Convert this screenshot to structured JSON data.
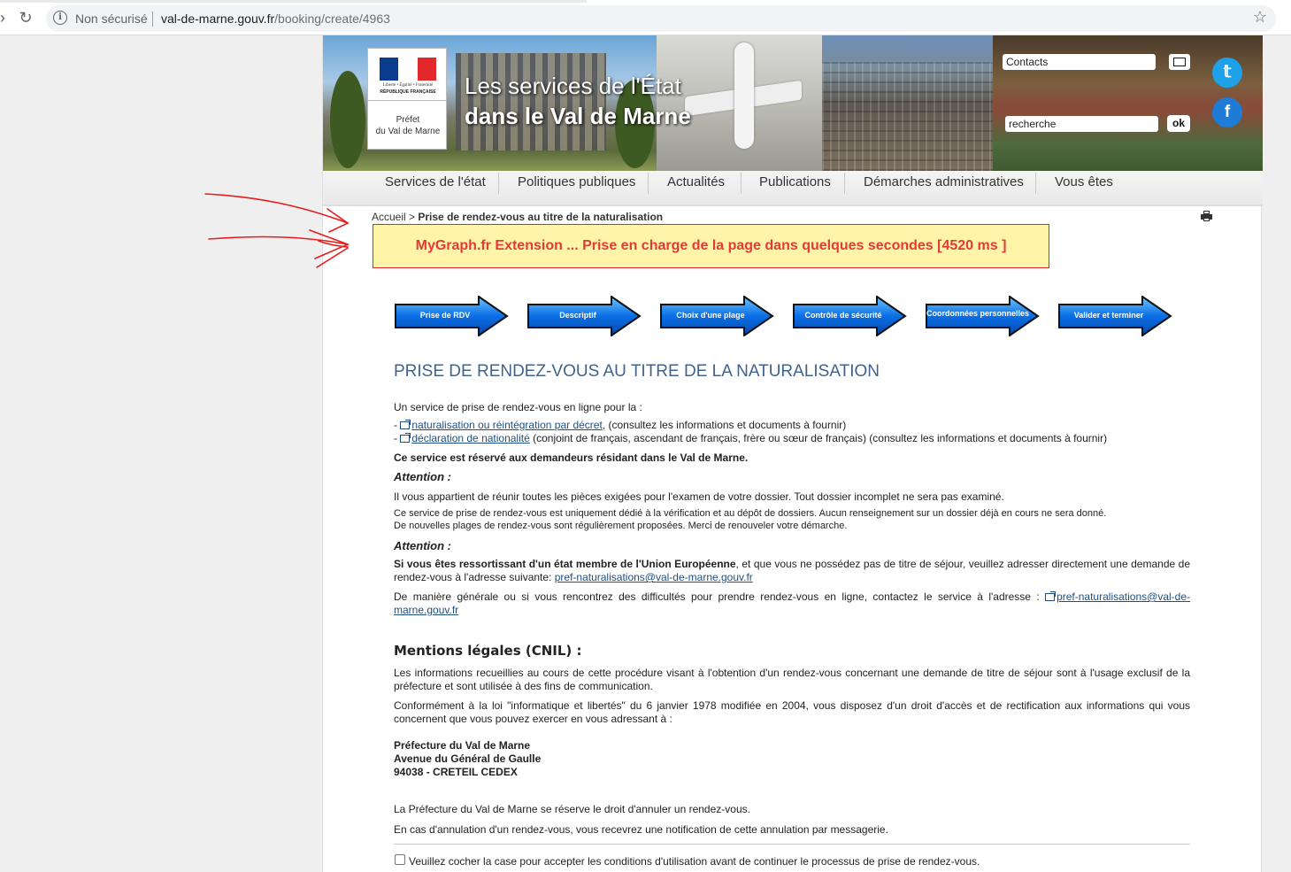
{
  "browser": {
    "security": "Non sécurisé",
    "url_host": "val-de-marne.gouv.fr",
    "url_path": "/booking/create/4963"
  },
  "banner": {
    "logo_motto": "Liberté • Égalité • Fraternité",
    "logo_republic": "RÉPUBLIQUE FRANÇAISE",
    "logo_prefet_line1": "Préfet",
    "logo_prefet_line2": "du Val de Marne",
    "title_line1": "Les services de l'État",
    "title_line2": "dans le Val de Marne",
    "contacts": "Contacts",
    "search_value": "recherche",
    "ok": "ok",
    "flag_colors": [
      "#0b3d8f",
      "#ffffff",
      "#e3282c"
    ],
    "twitter_color": "#1ea1e8",
    "facebook_color": "#1e7bd6"
  },
  "menu": {
    "items": [
      "Services de l'état",
      "Politiques publiques",
      "Actualités",
      "Publications",
      "Démarches administratives",
      "Vous êtes"
    ]
  },
  "breadcrumb": {
    "home": "Accueil",
    "sep": " > ",
    "current": "Prise de rendez-vous au titre de la naturalisation"
  },
  "notice": "MyGraph.fr Extension ... Prise en charge de la page dans quelques secondes [4520 ms ]",
  "steps": [
    "Prise de RDV",
    "Descriptif",
    "Choix d'une plage",
    "Contrôle de sécurité",
    "Coordonnées personnelles",
    "Valider et terminer"
  ],
  "content": {
    "title": "PRISE DE RENDEZ-VOUS AU TITRE DE LA NATURALISATION",
    "intro": "Un service de prise de rendez-vous en ligne pour la  :",
    "dash": "- ",
    "link1": "naturalisation ou réintégration par décret",
    "link1_rest": ",  (consultez les informations et documents à fournir)",
    "link2": "déclaration de nationalité",
    "link2_rest": "  (conjoint de français, ascendant de français, frère ou sœur de français) (consultez les informations et documents à fournir)",
    "reserved": "Ce service est réservé aux demandeurs résidant dans le Val de Marne.",
    "attention": "Attention  :",
    "pieces": " Il vous appartient de réunir toutes les pièces exigées pour l'examen de votre dossier. Tout dossier incomplet ne sera pas examiné.",
    "dedie": "Ce service de prise de rendez-vous est uniquement dédié à la vérification et au dépôt de dossiers. Aucun renseignement sur un dossier déjà en cours ne sera donné.",
    "nouvelles": "De nouvelles plages de rendez-vous sont régulièrement proposées. Merci de renouveler votre démarche.",
    "ue_bold": "Si vous êtes ressortissant d'un état membre de l'Union Européenne",
    "ue_rest": ", et que vous ne possédez pas de titre de séjour, veuillez adresser directement une demande de rendez-vous à l'adresse suivante:  ",
    "ue_email": "pref-naturalisations@val-de-marne.gouv.fr",
    "general": "De manière générale ou si vous rencontrez des difficultés pour prendre rendez-vous en ligne, contactez le service à l'adresse : ",
    "general_email": "pref-naturalisations@val-de-marne.gouv.fr",
    "cnil_title": "Mentions légales (CNIL) :",
    "cnil1": "Les informations recueillies au cours de cette procédure visant à l'obtention d'un rendez-vous concernant une demande de titre de séjour sont à l'usage exclusif de la préfecture et sont utilisée à des fins de communication.",
    "cnil2": "Conformément à la loi \"informatique et libertés\" du 6 janvier 1978 modifiée en 2004, vous disposez d'un droit d'accès et de rectification aux informations qui vous concernent que vous pouvez exercer en vous adressant à :",
    "addr1": "Préfecture du Val de Marne",
    "addr2": "Avenue du Général de Gaulle",
    "addr3": "94038 - CRETEIL CEDEX",
    "annul1": "La Préfecture du Val de Marne se réserve le droit d'annuler un rendez-vous.",
    "annul2": "En cas d'annulation d'un rendez-vous, vous recevrez une notification de cette annulation par messagerie.",
    "checkbox": "Veuillez cocher la case pour accepter les conditions d'utilisation avant de continuer le processus de prise de rendez-vous."
  },
  "colors": {
    "accent_title": "#40638c",
    "link": "#1f4f82",
    "notice_text": "#e33a3a",
    "notice_bg": "#fff4a8",
    "step_blue": "#0a6fe6",
    "annotation": "#e81c1c"
  },
  "icons": {
    "back": "back-arrow-icon",
    "reload": "reload-icon",
    "info": "info-icon",
    "star": "star-icon",
    "mail": "mail-icon",
    "twitter": "twitter-icon",
    "facebook": "facebook-icon",
    "print": "print-icon",
    "external": "external-link-icon"
  }
}
